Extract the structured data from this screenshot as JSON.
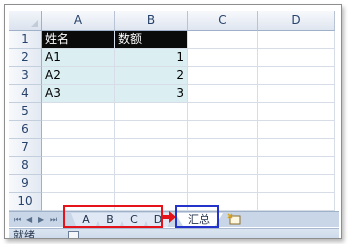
{
  "columns": [
    "A",
    "B",
    "C",
    "D"
  ],
  "rows": [
    "1",
    "2",
    "3",
    "4",
    "5",
    "6",
    "7",
    "8",
    "9",
    "10"
  ],
  "table": {
    "header": [
      "姓名",
      "数额"
    ],
    "body": [
      [
        "A1",
        "1"
      ],
      [
        "A2",
        "2"
      ],
      [
        "A3",
        "3"
      ]
    ]
  },
  "sheet_tabs": {
    "nav": [
      "⏮",
      "◀",
      "▶",
      "⏭"
    ],
    "items": [
      "A",
      "B",
      "C",
      "D",
      "汇总"
    ],
    "active": "汇总"
  },
  "status": {
    "text": "就绪"
  },
  "annotations": {
    "group_box_color": "#e5141b",
    "summary_box_color": "#2433c9",
    "arrow_color": "#e5141b"
  },
  "colors": {
    "header_fill": "#0a0a0a",
    "data_fill": "#dbeef2"
  }
}
